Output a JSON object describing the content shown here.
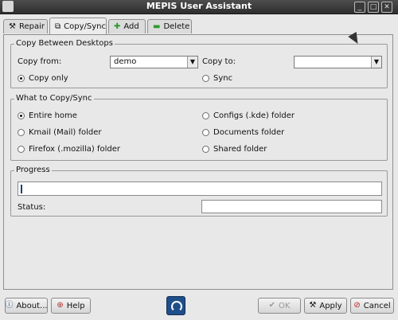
{
  "window": {
    "title": "MEPIS User Assistant",
    "buttons": [
      "minimize",
      "maximize",
      "close"
    ]
  },
  "tabs": [
    {
      "label": "Repair",
      "icon": "hammer-icon",
      "active": false
    },
    {
      "label": "Copy/Sync",
      "icon": "copy-icon",
      "active": true
    },
    {
      "label": "Add",
      "icon": "plus-icon",
      "active": false
    },
    {
      "label": "Delete",
      "icon": "minus-icon",
      "active": false
    }
  ],
  "copy_between": {
    "title": "Copy Between Desktops",
    "copy_from_label": "Copy from:",
    "copy_from_value": "demo",
    "copy_to_label": "Copy to:",
    "copy_to_value": "",
    "copy_only_label": "Copy only",
    "sync_label": "Sync",
    "mode": "copy_only"
  },
  "what_to_copy": {
    "title": "What to Copy/Sync",
    "options": [
      {
        "label": "Entire home",
        "selected": true
      },
      {
        "label": "Configs (.kde) folder",
        "selected": false
      },
      {
        "label": "Kmail (Mail) folder",
        "selected": false
      },
      {
        "label": "Documents folder",
        "selected": false
      },
      {
        "label": "Firefox (.mozilla) folder",
        "selected": false
      },
      {
        "label": "Shared folder",
        "selected": false
      }
    ]
  },
  "progress": {
    "title": "Progress",
    "status_label": "Status:",
    "status_value": ""
  },
  "footer": {
    "about_label": "About...",
    "help_label": "Help",
    "ok_label": "OK",
    "apply_label": "Apply",
    "cancel_label": "Cancel"
  },
  "colors": {
    "titlebar": "#3a3a3a",
    "background": "#e8e8e8"
  }
}
